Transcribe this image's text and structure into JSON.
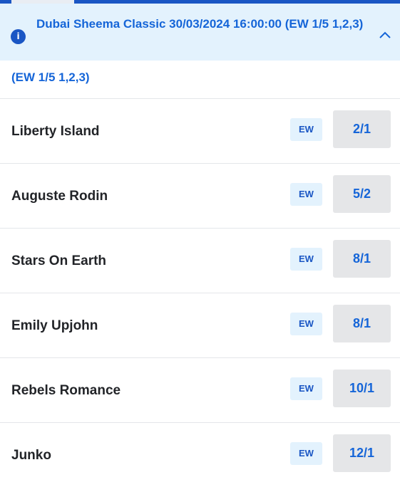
{
  "race": {
    "title": "Dubai Sheema Classic 30/03/2024 16:00:00 (EW 1/5 1,2,3)",
    "terms": "(EW 1/5 1,2,3)"
  },
  "icons": {
    "info": "info-icon",
    "collapse": "chevron-up-icon"
  },
  "colors": {
    "accent": "#1565d8",
    "header_bg": "#e3f2fd",
    "odds_bg": "#e5e6e8"
  },
  "runners": [
    {
      "name": "Liberty Island",
      "ew": "EW",
      "odds": "2/1"
    },
    {
      "name": "Auguste Rodin",
      "ew": "EW",
      "odds": "5/2"
    },
    {
      "name": "Stars On Earth",
      "ew": "EW",
      "odds": "8/1"
    },
    {
      "name": "Emily Upjohn",
      "ew": "EW",
      "odds": "8/1"
    },
    {
      "name": "Rebels Romance",
      "ew": "EW",
      "odds": "10/1"
    },
    {
      "name": "Junko",
      "ew": "EW",
      "odds": "12/1"
    }
  ]
}
